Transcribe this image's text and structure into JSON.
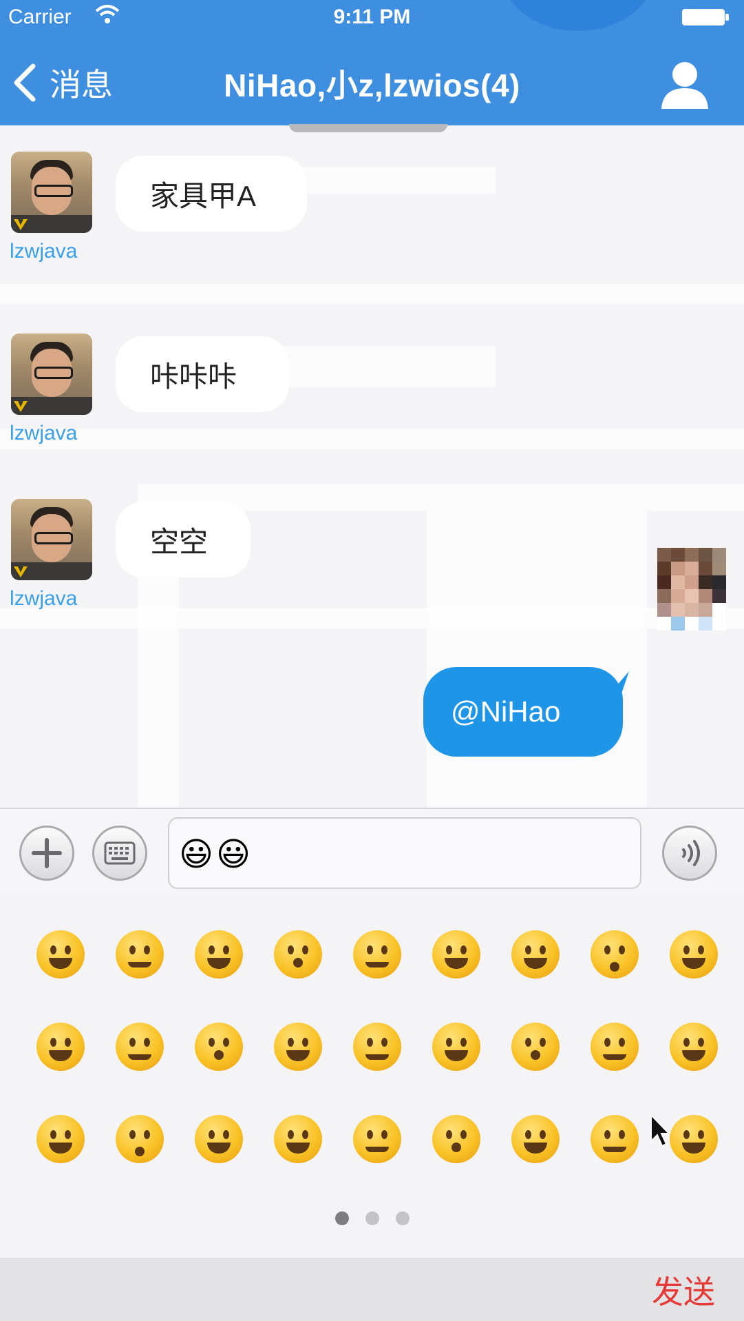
{
  "status_bar": {
    "carrier": "Carrier",
    "time": "9:11 PM",
    "icons": [
      "wifi-icon",
      "battery-icon"
    ]
  },
  "nav": {
    "back_label": "消息",
    "title": "NiHao,小z,lzwios(4)",
    "icons": [
      "chevron-left-icon",
      "person-icon"
    ],
    "bg_color": "#3e8fe0"
  },
  "messages": [
    {
      "sender": "lzwjava",
      "text": "家具甲A",
      "direction": "incoming"
    },
    {
      "sender": "lzwjava",
      "text": "咔咔咔",
      "direction": "incoming"
    },
    {
      "sender": "lzwjava",
      "text": "空空",
      "direction": "incoming"
    },
    {
      "sender": "",
      "text": "@NiHao",
      "direction": "outgoing"
    }
  ],
  "input": {
    "value": "😃😃",
    "icons": [
      "plus-icon",
      "keyboard-icon",
      "voice-icon"
    ]
  },
  "emoji_panel": {
    "rows": 3,
    "columns": 9,
    "page_count": 3,
    "active_page": 1
  },
  "send_bar": {
    "send_label": "发送",
    "send_color": "#e53935"
  },
  "colors": {
    "accent": "#3e8fe0",
    "outgoing_bubble": "#1f95e8",
    "sender_name": "#3aa0e8"
  }
}
